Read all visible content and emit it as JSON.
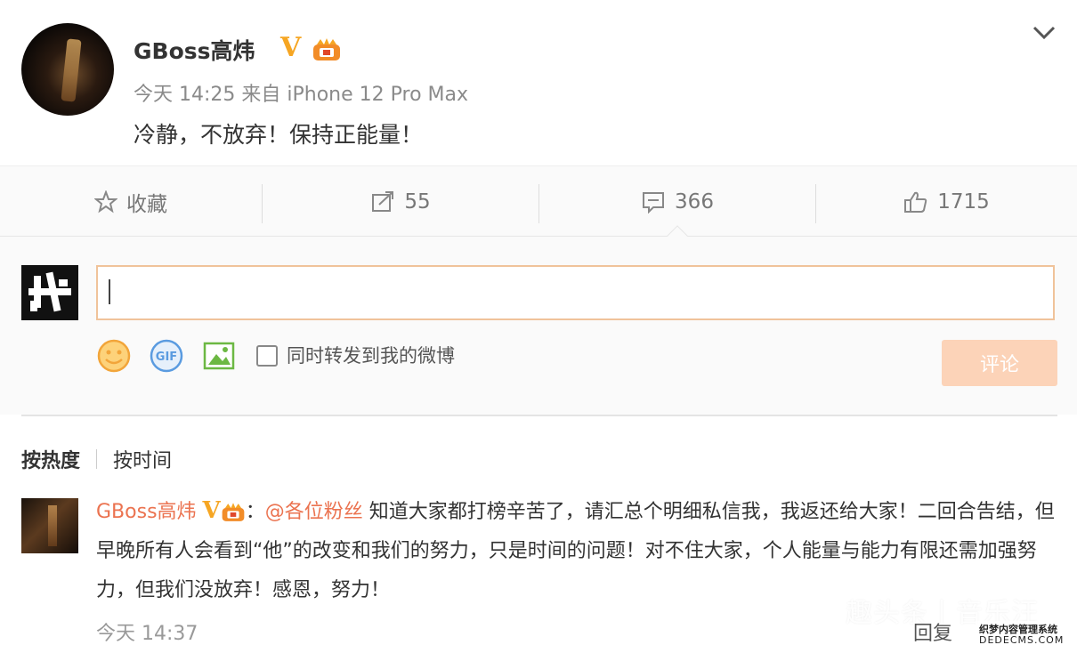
{
  "post": {
    "username": "GBoss高炜",
    "verified_badge": "V",
    "time": "今天 14:25",
    "source": "来自 iPhone 12 Pro Max",
    "text": "冷静，不放弃！保持正能量！",
    "menu_icon": "chevron-down-icon"
  },
  "actions": {
    "favorite": {
      "label": "收藏",
      "icon": "star-icon"
    },
    "repost": {
      "label": "55",
      "icon": "repost-icon"
    },
    "comment": {
      "label": "366",
      "icon": "comment-icon"
    },
    "like": {
      "label": "1715",
      "icon": "thumbs-up-icon"
    }
  },
  "composer": {
    "input_value": "",
    "tools": [
      "emoji-icon",
      "gif-icon",
      "image-icon"
    ],
    "also_repost_label": "同时转发到我的微博",
    "submit_label": "评论"
  },
  "sort": {
    "by_hot": "按热度",
    "by_time": "按时间"
  },
  "comment": {
    "username": "GBoss高炜",
    "verified_badge": "V",
    "colon": "：",
    "mention": "@各位粉丝",
    "text": " 知道大家都打榜辛苦了，请汇总个明细私信我，我返还给大家！二回合告结，但早晚所有人会看到“他”的改变和我们的努力，只是时间的问题！对不住大家，个人能量与能力有限还需加强努力，但我们没放弃！感恩，努力！",
    "time": "今天 14:37",
    "reply_label": "回复"
  },
  "watermark": {
    "text": "趣头条丨音乐汪",
    "site_line1": "织梦内容管理系统",
    "site_line2": "DEDECMS.COM"
  },
  "colors": {
    "accent": "#eb7350",
    "badge": "#f6a623",
    "submit_disabled": "#fcd3b8"
  }
}
